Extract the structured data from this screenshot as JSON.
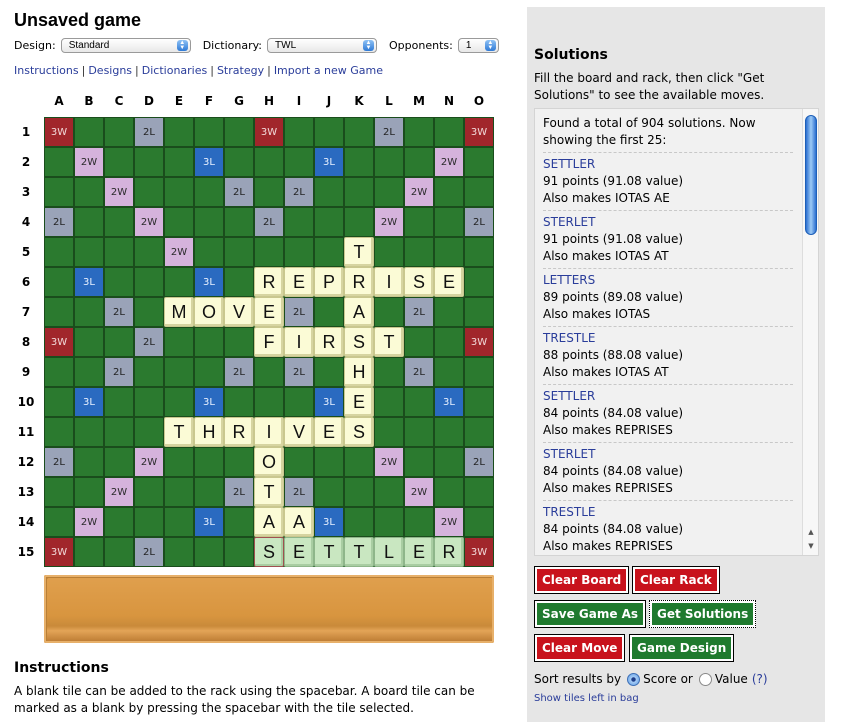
{
  "title": "Unsaved game",
  "controls": {
    "design_label": "Design:",
    "design_value": "Standard",
    "dictionary_label": "Dictionary:",
    "dictionary_value": "TWL",
    "opponents_label": "Opponents:",
    "opponents_value": "1"
  },
  "links": [
    "Instructions",
    "Designs",
    "Dictionaries",
    "Strategy",
    "Import a new Game"
  ],
  "board": {
    "columns": [
      "A",
      "B",
      "C",
      "D",
      "E",
      "F",
      "G",
      "H",
      "I",
      "J",
      "K",
      "L",
      "M",
      "N",
      "O"
    ],
    "rows": [
      "1",
      "2",
      "3",
      "4",
      "5",
      "6",
      "7",
      "8",
      "9",
      "10",
      "11",
      "12",
      "13",
      "14",
      "15"
    ],
    "premium_labels": {
      "tw": "3W",
      "dw": "2W",
      "tl": "3L",
      "dl": "2L"
    },
    "premiums": {
      "tw": [
        "0,0",
        "0,7",
        "0,14",
        "7,0",
        "7,14",
        "14,0",
        "14,7",
        "14,14"
      ],
      "dw": [
        "1,1",
        "2,2",
        "3,3",
        "4,4",
        "1,13",
        "2,12",
        "3,11",
        "4,10",
        "10,4",
        "11,3",
        "12,2",
        "13,1",
        "10,10",
        "11,11",
        "12,12",
        "13,13",
        "7,7"
      ],
      "tl": [
        "1,5",
        "1,9",
        "5,1",
        "5,5",
        "5,9",
        "5,13",
        "9,1",
        "9,5",
        "9,9",
        "9,13",
        "13,5",
        "13,9"
      ],
      "dl": [
        "0,3",
        "0,11",
        "2,6",
        "2,8",
        "3,0",
        "3,7",
        "3,14",
        "6,2",
        "6,6",
        "6,8",
        "6,12",
        "7,3",
        "7,11",
        "8,2",
        "8,6",
        "8,8",
        "8,12",
        "11,0",
        "11,7",
        "11,14",
        "12,6",
        "12,8",
        "14,3",
        "14,11"
      ]
    },
    "tiles": [
      {
        "pos": "K5",
        "letter": "T"
      },
      {
        "pos": "H6",
        "letter": "R"
      },
      {
        "pos": "I6",
        "letter": "E"
      },
      {
        "pos": "J6",
        "letter": "P"
      },
      {
        "pos": "K6",
        "letter": "R"
      },
      {
        "pos": "L6",
        "letter": "I"
      },
      {
        "pos": "M6",
        "letter": "S"
      },
      {
        "pos": "N6",
        "letter": "E"
      },
      {
        "pos": "E7",
        "letter": "M"
      },
      {
        "pos": "F7",
        "letter": "O"
      },
      {
        "pos": "G7",
        "letter": "V"
      },
      {
        "pos": "H7",
        "letter": "E"
      },
      {
        "pos": "K7",
        "letter": "A"
      },
      {
        "pos": "H8",
        "letter": "F"
      },
      {
        "pos": "I8",
        "letter": "I"
      },
      {
        "pos": "J8",
        "letter": "R"
      },
      {
        "pos": "K8",
        "letter": "S"
      },
      {
        "pos": "L8",
        "letter": "T"
      },
      {
        "pos": "K9",
        "letter": "H"
      },
      {
        "pos": "K10",
        "letter": "E"
      },
      {
        "pos": "E11",
        "letter": "T"
      },
      {
        "pos": "F11",
        "letter": "H"
      },
      {
        "pos": "G11",
        "letter": "R"
      },
      {
        "pos": "H11",
        "letter": "I"
      },
      {
        "pos": "I11",
        "letter": "V"
      },
      {
        "pos": "J11",
        "letter": "E"
      },
      {
        "pos": "K11",
        "letter": "S"
      },
      {
        "pos": "H12",
        "letter": "O"
      },
      {
        "pos": "H13",
        "letter": "T"
      },
      {
        "pos": "H14",
        "letter": "A"
      },
      {
        "pos": "I14",
        "letter": "A"
      },
      {
        "pos": "H15",
        "letter": "S",
        "new": true
      },
      {
        "pos": "I15",
        "letter": "E",
        "new": true
      },
      {
        "pos": "J15",
        "letter": "T",
        "new": true
      },
      {
        "pos": "K15",
        "letter": "T",
        "new": true
      },
      {
        "pos": "L15",
        "letter": "L",
        "new": true
      },
      {
        "pos": "M15",
        "letter": "E",
        "new": true
      },
      {
        "pos": "N15",
        "letter": "R",
        "new": true
      }
    ]
  },
  "rack": {
    "tiles": []
  },
  "instructions": {
    "heading": "Instructions",
    "text": "A blank tile can be added to the rack using the spacebar. A board tile can be marked as a blank by pressing the spacebar with the tile selected."
  },
  "solutions": {
    "heading": "Solutions",
    "description": "Fill the board and rack, then click \"Get Solutions\" to see the available moves.",
    "summary": "Found a total of 904 solutions. Now showing the first 25:",
    "items": [
      {
        "word": "SETTLER",
        "score": "91 points (91.08 value)",
        "also": "Also makes IOTAS AE"
      },
      {
        "word": "STERLET",
        "score": "91 points (91.08 value)",
        "also": "Also makes IOTAS AT"
      },
      {
        "word": "LETTERS",
        "score": "89 points (89.08 value)",
        "also": "Also makes IOTAS"
      },
      {
        "word": "TRESTLE",
        "score": "88 points (88.08 value)",
        "also": "Also makes IOTAS AT"
      },
      {
        "word": "SETTLER",
        "score": "84 points (84.08 value)",
        "also": "Also makes REPRISES"
      },
      {
        "word": "STERLET",
        "score": "84 points (84.08 value)",
        "also": "Also makes REPRISES"
      },
      {
        "word": "TRESTLE",
        "score": "84 points (84.08 value)",
        "also": "Also makes REPRISES"
      }
    ]
  },
  "buttons": {
    "clear_board": "Clear Board",
    "clear_rack": "Clear Rack",
    "save_game_as": "Save Game As",
    "get_solutions": "Get Solutions",
    "clear_move": "Clear Move",
    "game_design": "Game Design"
  },
  "sort": {
    "label": "Sort results by",
    "option_score": "Score or",
    "option_value": "Value",
    "selected": "score",
    "help": "(?)"
  },
  "bag_link": "Show tiles left in bag",
  "colors": {
    "triple_word": "#a1262b",
    "double_word": "#d5b3dc",
    "triple_letter": "#2a6ac0",
    "double_letter": "#9aa3b8",
    "board_green": "#2b7a2f",
    "tile": "#fbfbd6",
    "new_tile": "#c9e7c1",
    "button_red": "#c8121c",
    "button_green": "#1f7a2e",
    "link": "#2a3d9a"
  }
}
